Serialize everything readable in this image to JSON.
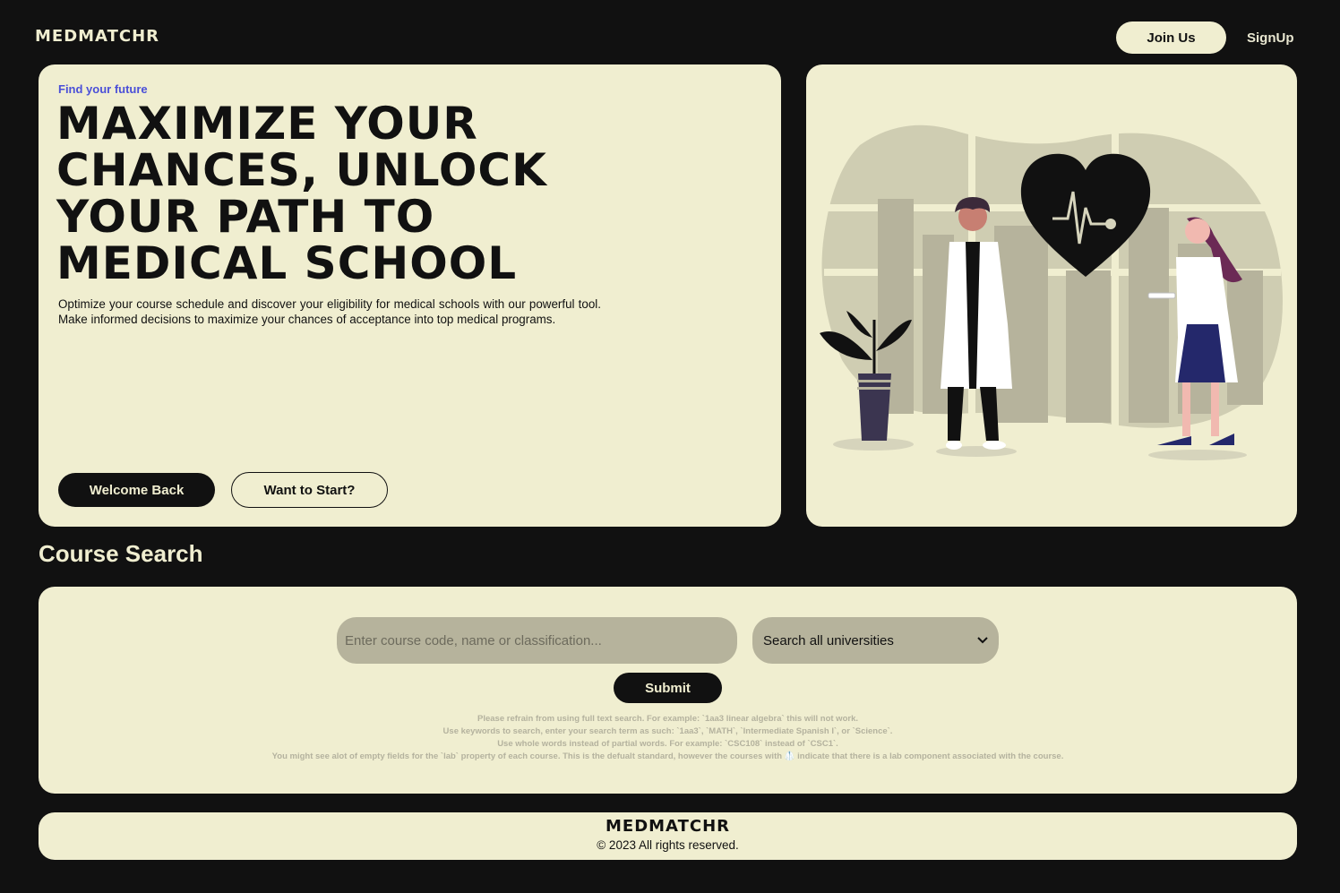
{
  "brand": {
    "logo": "MEDMATCHR"
  },
  "nav": {
    "join_label": "Join Us",
    "signup_label": "SignUp"
  },
  "hero": {
    "eyebrow": "Find your future",
    "headline": "MAXIMIZE YOUR CHANCES, UNLOCK YOUR PATH TO MEDICAL SCHOOL",
    "description": "Optimize your course schedule and discover your eligibility for medical schools with our powerful tool. Make informed decisions to maximize your chances of acceptance into top medical programs.",
    "welcome_label": "Welcome Back",
    "start_label": "Want to Start?"
  },
  "course_search": {
    "title": "Course Search",
    "placeholder": "Enter course code, name or classification...",
    "university_selected": "Search all universities",
    "submit_label": "Submit",
    "notes": [
      "Please refrain from using full text search. For example: `1aa3 linear algebra` this will not work.",
      "Use keywords to search, enter your search term as such: `1aa3`, `MATH`, `Intermediate Spanish I`, or `Science`.",
      "Use whole words instead of partial words. For example: `CSC108` instead of `CSC1`.",
      "You might see alot of empty fields for the `lab` property of each course. This is the defualt standard, however the courses with 🥼 indicate that there is a lab component associated with the course."
    ]
  },
  "footer": {
    "logo": "MEDMATCHR",
    "copyright": "© 2023 All rights reserved."
  },
  "icons": {
    "select_arrow": "chevron-down-icon",
    "illustration": "doctors-heart-illustration"
  },
  "colors": {
    "background": "#111111",
    "card": "#f0eed0",
    "accent": "#4a4fd8",
    "field": "#b6b39c"
  }
}
